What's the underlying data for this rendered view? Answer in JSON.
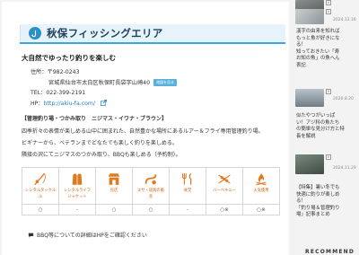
{
  "section": {
    "title": "秋保フィッシングエリア",
    "subtitle": "大自然でゆったり釣りを楽しむ"
  },
  "info": {
    "address_label": "住所：",
    "postal": "〒982-0243",
    "address": "宮城県仙台市太白区秋保町長袋字山崎40",
    "map_button": "地図を見る",
    "tel_label": "TEL：",
    "tel": "022-399-2191",
    "hp_label": "HP：",
    "url": "http://akiu-fa.com/"
  },
  "description": {
    "heading": "【管理釣り場・つかみ取り　ニジマス・イワナ・ブラウン】",
    "line1": "四季折々の表情が楽しめる山中に囲まれた、自然豊かな場所にあるルアー＆フライ専用管理釣り場。",
    "line2": "ビギナーから、ベテランまでどなたでも楽しく釣りを楽しめる。",
    "line3": "隣接の沢にてニジマスのつかみ取り、BBQも楽しめる（予約制）。"
  },
  "facilities": [
    {
      "icon": "rental-tackle-icon",
      "label1": "レンタルタックル",
      "label2": "ル",
      "mark": "○"
    },
    {
      "icon": "rental-lifejacket-icon",
      "label1": "レンタルライフ",
      "label2": "ジャケット",
      "mark": "-"
    },
    {
      "icon": "shop-icon",
      "label1": "売店",
      "label2": "",
      "mark": "○"
    },
    {
      "icon": "bait-icon",
      "label1": "エサ・道具の販",
      "label2": "売",
      "mark": "○"
    },
    {
      "icon": "restaurant-icon",
      "label1": "食堂",
      "label2": "",
      "mark": "-"
    },
    {
      "icon": "bbq-icon",
      "label1": "バーベキュー",
      "label2": "",
      "mark": "○※"
    },
    {
      "icon": "fire-icon",
      "label1": "火気使用",
      "label2": "",
      "mark": "○※"
    }
  ],
  "note": "BBQ等についての詳細はHPをご確認ください",
  "colors": {
    "accent": "#39a7df",
    "title_bg": "#e6f3fa",
    "facility_label": "#d45b00"
  },
  "sidebar": {
    "items": [
      {
        "badge": "0",
        "date": "",
        "text": [
          "",
          ""
        ]
      },
      {
        "badge": "0",
        "date": "2024.12.16",
        "text": [
          "漢字の由来を知れば",
          "もっと魚が好きにな",
          "る！",
          "知っておきたい「寿",
          "お知の魚」の魚へん",
          "表記"
        ]
      },
      {
        "badge": "0",
        "date": "2020.8.20",
        "text": [
          "似たやつがいっぱ",
          "い！アジ科の魚たち",
          "の簡単な見分け方と特",
          "長を解説"
        ]
      },
      {
        "badge": "0",
        "date": "2024.11.29",
        "text": [
          "【特集】暑い冬でも",
          "快適に釣りが楽しめ",
          "る！",
          "「釣り場＆管理釣り",
          "場」記事まとめ"
        ]
      }
    ],
    "heading": "RECOMMEND"
  }
}
